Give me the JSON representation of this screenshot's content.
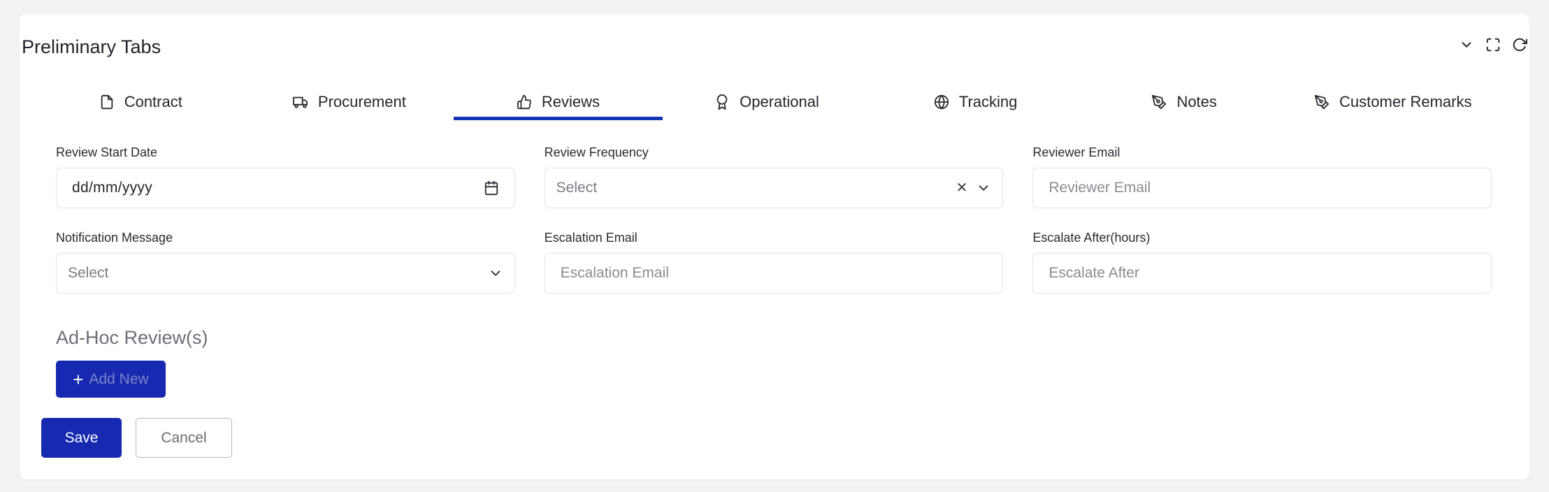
{
  "panel": {
    "title": "Preliminary Tabs"
  },
  "tools": [
    {
      "icon": "chevron-down-icon"
    },
    {
      "icon": "fullscreen-icon"
    },
    {
      "icon": "refresh-icon"
    }
  ],
  "tabs": [
    {
      "label": "Contract",
      "icon": "file-icon"
    },
    {
      "label": "Procurement",
      "icon": "truck-icon"
    },
    {
      "label": "Reviews",
      "icon": "thumbs-up-icon",
      "active": true
    },
    {
      "label": "Operational",
      "icon": "award-icon"
    },
    {
      "label": "Tracking",
      "icon": "globe-icon"
    },
    {
      "label": "Notes",
      "icon": "pen-tool-icon"
    },
    {
      "label": "Customer Remarks",
      "icon": "pen-tool-icon"
    }
  ],
  "form": {
    "review_start_date": {
      "label": "Review Start Date",
      "value": "dd/mm/yyyy"
    },
    "review_frequency": {
      "label": "Review Frequency",
      "placeholder": "Select"
    },
    "reviewer_email": {
      "label": "Reviewer Email",
      "placeholder": "Reviewer Email"
    },
    "notification_message": {
      "label": "Notification Message",
      "placeholder": "Select"
    },
    "escalation_email": {
      "label": "Escalation Email",
      "placeholder": "Escalation Email"
    },
    "escalate_after": {
      "label": "Escalate After(hours)",
      "placeholder": "Escalate After"
    }
  },
  "adhoc": {
    "title": "Ad-Hoc Review(s)",
    "add_plus": "+",
    "add_label": "Add New"
  },
  "actions": {
    "save": "Save",
    "cancel": "Cancel"
  },
  "colors": {
    "accent": "#1729b0",
    "tab_indicator": "#1533b4"
  }
}
